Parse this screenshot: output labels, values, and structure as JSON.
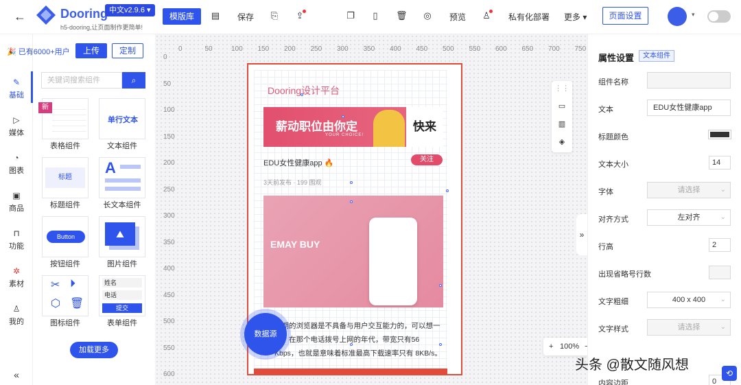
{
  "header": {
    "brand": "Dooring",
    "slogan": "h5-dooring,让页面制作更简单!",
    "version": "中文v2.9.6 ▾",
    "template_btn": "模版库",
    "save": "保存",
    "preview": "预览",
    "private_deploy": "私有化部署",
    "more": "更多 ▾",
    "page_settings": "页面设置"
  },
  "panel": {
    "user_count": "🎉 已有6000+用户",
    "upload": "上传",
    "customize": "定制",
    "search_placeholder": "关键词搜索组件",
    "new_badge": "新",
    "cards": [
      {
        "label": "表格组件"
      },
      {
        "label": "文本组件",
        "preview": "单行文本"
      },
      {
        "label": "标题组件",
        "preview": "标题"
      },
      {
        "label": "长文本组件"
      },
      {
        "label": "按钮组件",
        "preview": "Button"
      },
      {
        "label": "图片组件"
      },
      {
        "label": "图标组件"
      },
      {
        "label": "表单组件",
        "field1": "姓名",
        "field2": "电话",
        "submit": "提交"
      }
    ],
    "load_more": "加载更多"
  },
  "nav": [
    {
      "label": "基础"
    },
    {
      "label": "媒体"
    },
    {
      "label": "图表"
    },
    {
      "label": "商品"
    },
    {
      "label": "功能"
    },
    {
      "label": "素材"
    },
    {
      "label": "我的"
    }
  ],
  "ruler": {
    "h": [
      "0",
      "50",
      "100",
      "150",
      "200",
      "250",
      "300",
      "350",
      "400",
      "450",
      "500",
      "550",
      "600",
      "650",
      "700",
      "750"
    ],
    "v": [
      "0",
      "50",
      "100",
      "150",
      "200",
      "250",
      "300",
      "350",
      "400",
      "450",
      "500",
      "550",
      "600"
    ]
  },
  "phone": {
    "title": "Dooring设计平台",
    "banner_text": "薪动职位由你定",
    "banner_sub": "YOUR CHOICE!",
    "banner_right": "快来",
    "article_title": "EDU女性健康app 🔥",
    "follow": "关注",
    "meta": "3天前发布 · 199 围观",
    "image_text": "EMAY BUY",
    "paragraph": "早期的浏览器是不具备与用户交互能力的，可以想一下，在那个电话拨号上网的年代，带宽只有56 Kbps，也就是意味着标准最高下载速率只有 8KB/s。",
    "data_source": "数据源"
  },
  "zoom": "100%",
  "props": {
    "title": "属性设置",
    "tag": "文本组件",
    "fields": [
      {
        "label": "组件名称",
        "value": ""
      },
      {
        "label": "文本",
        "value": "EDU女性健康app"
      },
      {
        "label": "标题颜色",
        "value": "#333333"
      },
      {
        "label": "文本大小",
        "value": "14"
      },
      {
        "label": "字体",
        "value": "请选择"
      },
      {
        "label": "对齐方式",
        "value": "左对齐"
      },
      {
        "label": "行高",
        "value": "2"
      },
      {
        "label": "出现省略号行数",
        "value": ""
      },
      {
        "label": "文字粗细",
        "value": "400 x 400"
      },
      {
        "label": "文字样式",
        "value": "请选择"
      },
      {
        "label": "内容边距",
        "value": "0"
      }
    ]
  },
  "watermark": "头条 @散文随风想"
}
